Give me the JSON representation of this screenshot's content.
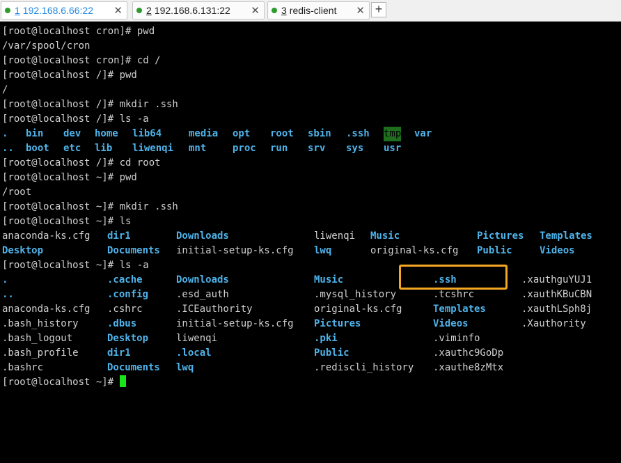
{
  "tabs": [
    {
      "num": "1",
      "title": "192.168.6.66:22",
      "active": true,
      "close": "✕",
      "dot": "#2e9b2e"
    },
    {
      "num": "2",
      "title": "192.168.6.131:22",
      "active": false,
      "close": "✕",
      "dot": "#2e9b2e"
    },
    {
      "num": "3",
      "title": "redis-client",
      "active": false,
      "close": "✕",
      "dot": "#2e9b2e"
    }
  ],
  "add_tab_label": "+",
  "terminal": {
    "lines": [
      "[root@localhost cron]# pwd",
      "/var/spool/cron",
      "[root@localhost cron]# cd /",
      "[root@localhost /]# pwd",
      "/",
      "[root@localhost /]# mkdir .ssh",
      "[root@localhost /]# ls -a"
    ],
    "ls_root": {
      "row1": [
        ".",
        "bin",
        "dev",
        "home",
        "lib64",
        "media",
        "opt",
        "root",
        "sbin",
        ".ssh",
        "tmp",
        "var"
      ],
      "row2": [
        "..",
        "boot",
        "etc",
        "lib",
        "liwenqi",
        "mnt",
        "proc",
        "run",
        "srv",
        "sys",
        "usr"
      ]
    },
    "lines2": [
      "[root@localhost /]# cd root",
      "[root@localhost ~]# pwd",
      "/root",
      "[root@localhost ~]# mkdir .ssh",
      "[root@localhost ~]# ls"
    ],
    "ls_home": {
      "row1": [
        "anaconda-ks.cfg",
        "dir1",
        "Downloads",
        "liwenqi",
        "Music",
        "Pictures",
        "Templates"
      ],
      "row2": [
        "Desktop",
        "Documents",
        "initial-setup-ks.cfg",
        "lwq",
        "original-ks.cfg",
        "Public",
        "Videos"
      ]
    },
    "ls_a_prompt": "[root@localhost ~]# ls -a",
    "ls_a_rows": [
      [
        ".",
        ".cache",
        "Downloads",
        "Music",
        ".ssh",
        ".xauthguYUJ1"
      ],
      [
        "..",
        ".config",
        ".esd_auth",
        ".mysql_history",
        ".tcshrc",
        ".xauthKBuCBN"
      ],
      [
        "anaconda-ks.cfg",
        ".cshrc",
        ".ICEauthority",
        "original-ks.cfg",
        "Templates",
        ".xauthLSph8j"
      ],
      [
        ".bash_history",
        ".dbus",
        "initial-setup-ks.cfg",
        "Pictures",
        "Videos",
        ".Xauthority"
      ],
      [
        ".bash_logout",
        "Desktop",
        "liwenqi",
        ".pki",
        ".viminfo",
        ""
      ],
      [
        ".bash_profile",
        "dir1",
        ".local",
        "Public",
        ".xauthc9GoDp",
        ""
      ],
      [
        ".bashrc",
        "Documents",
        "lwq",
        ".rediscli_history",
        ".xauthe8zMtx",
        ""
      ]
    ],
    "final_prompt": "[root@localhost ~]# "
  },
  "colors": {
    "directory": "#4fb3ea",
    "file": "#d0d0d0",
    "cursor": "#19e619",
    "highlight": "#f5a623"
  }
}
